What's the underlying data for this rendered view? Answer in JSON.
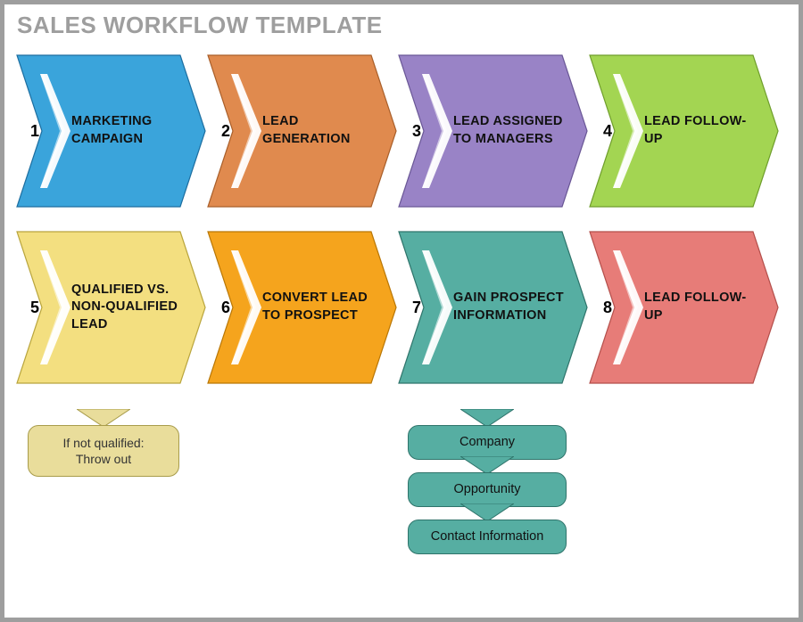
{
  "title": "SALES WORKFLOW TEMPLATE",
  "steps": [
    {
      "num": "1",
      "label": "MARKETING CAMPAIGN",
      "fill": "#3aa4db",
      "stroke": "#1d6ea0"
    },
    {
      "num": "2",
      "label": "LEAD GENERATION",
      "fill": "#e08a4e",
      "stroke": "#a95f2a"
    },
    {
      "num": "3",
      "label": "LEAD ASSIGNED TO MANAGERS",
      "fill": "#9983c6",
      "stroke": "#6a5796"
    },
    {
      "num": "4",
      "label": "LEAD FOLLOW-UP",
      "fill": "#a3d552",
      "stroke": "#6f9e2c"
    },
    {
      "num": "5",
      "label": "QUALIFIED VS. NON-QUALIFIED LEAD",
      "fill": "#f3df80",
      "stroke": "#b9a53d"
    },
    {
      "num": "6",
      "label": "CONVERT LEAD TO PROSPECT",
      "fill": "#f5a41d",
      "stroke": "#b97706"
    },
    {
      "num": "7",
      "label": "GAIN PROSPECT INFORMATION",
      "fill": "#56aea2",
      "stroke": "#2f746b"
    },
    {
      "num": "8",
      "label": "LEAD FOLLOW-UP",
      "fill": "#e77c78",
      "stroke": "#b44f4b"
    }
  ],
  "callouts": {
    "step5": {
      "label": "If not qualified:\nThrow out",
      "fill": "#e9dd9b"
    },
    "step7": [
      {
        "label": "Company"
      },
      {
        "label": "Opportunity"
      },
      {
        "label": "Contact Information"
      }
    ]
  }
}
